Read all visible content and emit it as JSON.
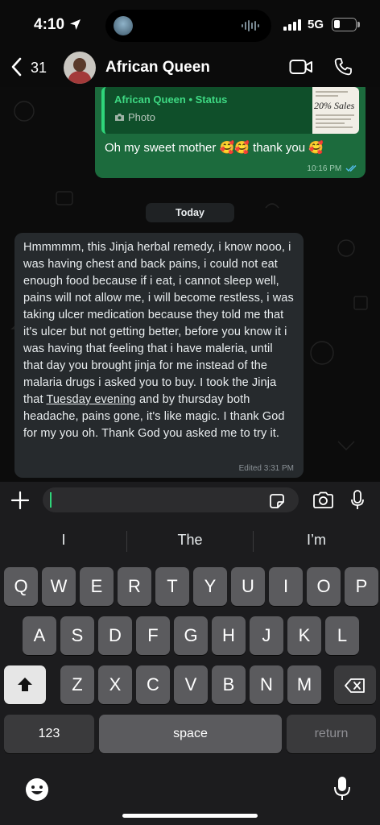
{
  "status_bar": {
    "time": "4:10",
    "network": "5G",
    "battery_level": 0.25
  },
  "header": {
    "unread_count": "31",
    "contact_name": "African Queen"
  },
  "messages": {
    "outgoing": {
      "quote_title": "African Queen • Status",
      "quote_type": "Photo",
      "quote_thumb_text": "20% Sales",
      "text": "Oh my sweet mother 🥰🥰 thank you 🥰",
      "time": "10:16 PM"
    },
    "date_divider": "Today",
    "incoming": {
      "text_before_link": "Hmmmmm, this Jinja herbal remedy, i know nooo, i was having chest and back pains, i could not eat enough food because if i eat, i cannot sleep well, pains will not allow me, i will become restless, i was taking ulcer medication because they told me that it's ulcer but not getting better, before you know it i was having that feeling that i have maleria, until that day you brought jinja for me instead of the malaria drugs i asked you to buy. I took the Jinja that ",
      "link_text": "Tuesday evening",
      "text_after_link": " and by thursday both headache, pains gone, it's like magic. I thank God for my you oh. Thank God you asked me to try it.",
      "time": "Edited 3:31 PM"
    }
  },
  "composer": {
    "value": ""
  },
  "keyboard": {
    "suggestions": [
      "I",
      "The",
      "I’m"
    ],
    "row1": [
      "Q",
      "W",
      "E",
      "R",
      "T",
      "Y",
      "U",
      "I",
      "O",
      "P"
    ],
    "row2": [
      "A",
      "S",
      "D",
      "F",
      "G",
      "H",
      "J",
      "K",
      "L"
    ],
    "row3": [
      "Z",
      "X",
      "C",
      "V",
      "B",
      "N",
      "M"
    ],
    "numbers_label": "123",
    "space_label": "space",
    "return_label": "return"
  },
  "icons": [
    "location-arrow-icon",
    "signal-icon",
    "battery-icon",
    "back-chevron-icon",
    "video-call-icon",
    "audio-call-icon",
    "camera-icon",
    "double-check-icon",
    "plus-icon",
    "sticker-icon",
    "mic-icon",
    "shift-icon",
    "delete-icon",
    "emoji-icon",
    "dictation-icon"
  ],
  "colors": {
    "outgoing_bubble": "#1c6b3d",
    "incoming_bubble": "#262a2d",
    "accent": "#2fd57a"
  }
}
